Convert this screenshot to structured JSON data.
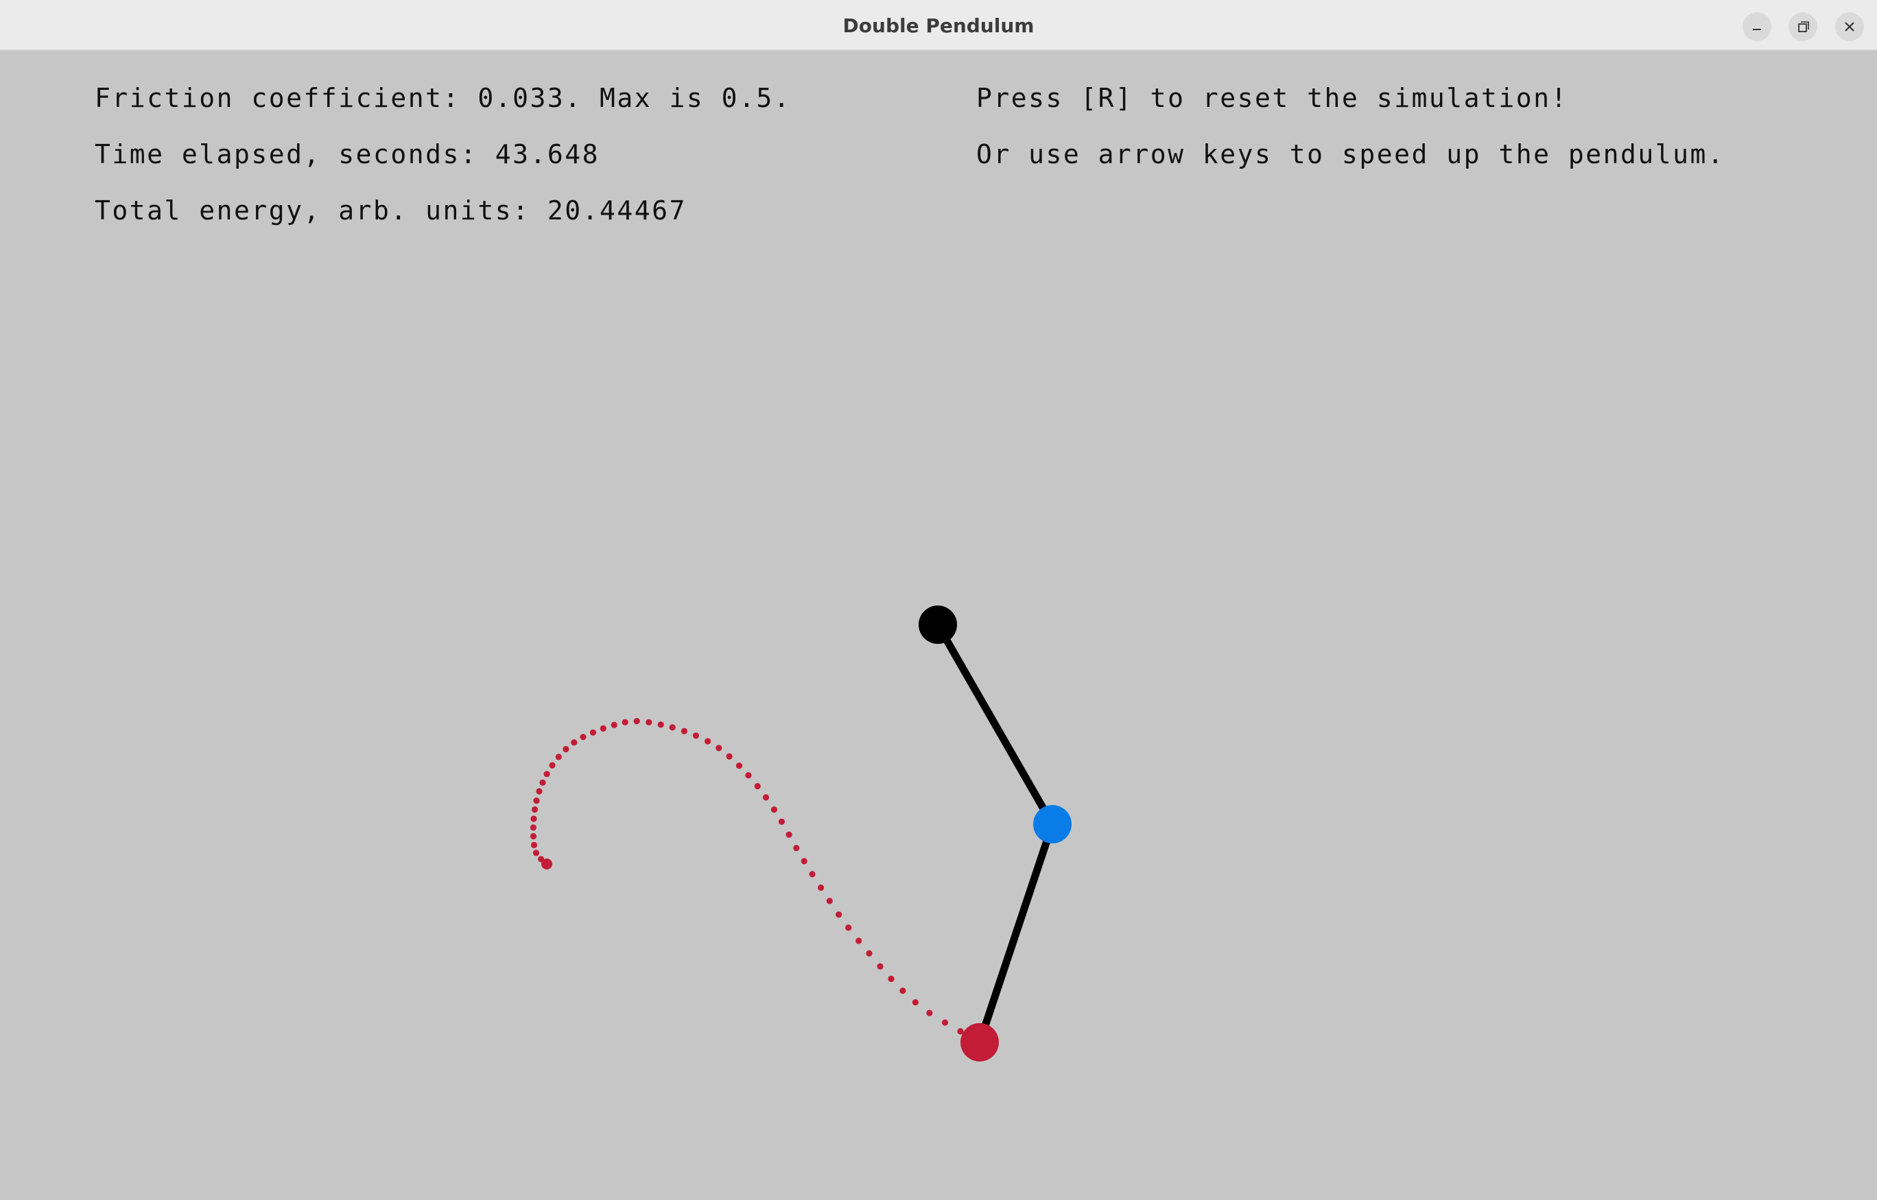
{
  "window": {
    "title": "Double Pendulum",
    "controls": [
      "minimize-icon",
      "restore-icon",
      "close-icon"
    ]
  },
  "info": {
    "friction": "Friction coefficient: 0.033. Max is 0.5.",
    "time": "Time elapsed, seconds: 43.648",
    "energy": "Total energy, arb. units: 20.44467",
    "reset_hint": "Press [R] to reset the simulation!",
    "arrow_hint": "Or use arrow keys to speed up the pendulum."
  },
  "colors": {
    "background": "#c6c6c6",
    "pivot": "#000000",
    "bob1": "#0a7ce8",
    "bob2": "#c21c36",
    "trail": "#c21c36",
    "rod": "#000000"
  }
}
